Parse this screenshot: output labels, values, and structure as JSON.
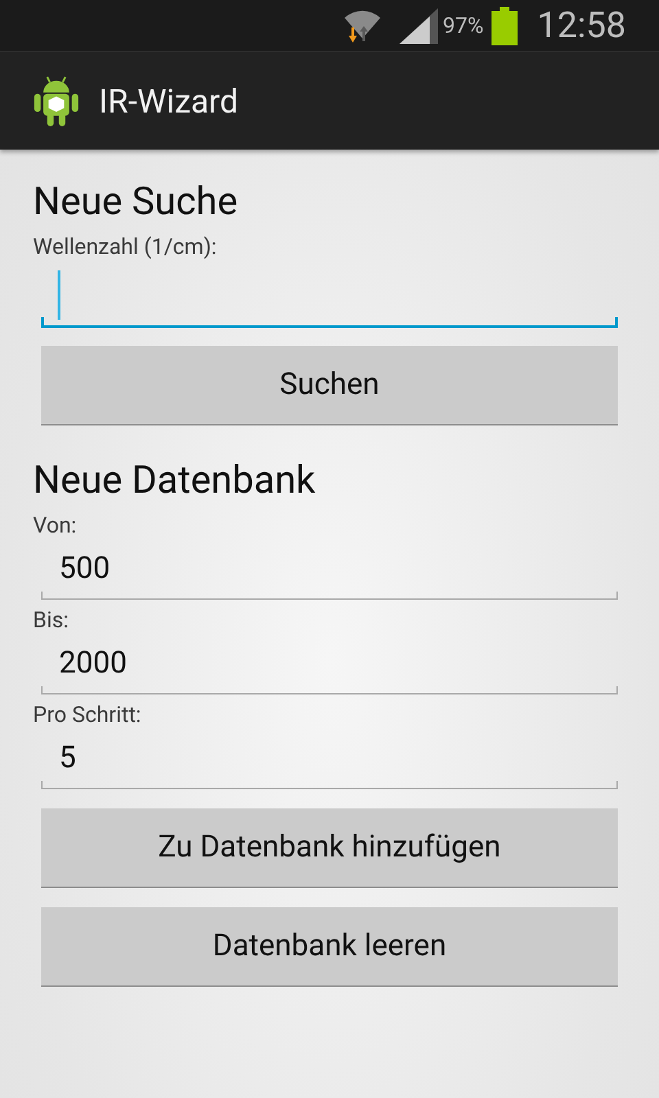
{
  "status_bar": {
    "battery": "97%",
    "time": "12:58"
  },
  "action_bar": {
    "title": "IR-Wizard"
  },
  "sections": [
    {
      "heading": "Neue Suche",
      "fields": [
        {
          "label": "Wellenzahl (1/cm):",
          "focused": true
        }
      ],
      "buttons": [
        "Suchen"
      ]
    },
    {
      "heading": "Neue Datenbank",
      "fields": [
        {
          "label": "Von:",
          "value": "500",
          "focused": false
        },
        {
          "label": "Bis:",
          "value": "2000",
          "focused": false
        },
        {
          "label": "Pro Schritt:",
          "value": "5",
          "focused": false
        }
      ],
      "buttons": [
        "Zu Datenbank hinzufügen",
        "Datenbank leeren"
      ]
    }
  ]
}
